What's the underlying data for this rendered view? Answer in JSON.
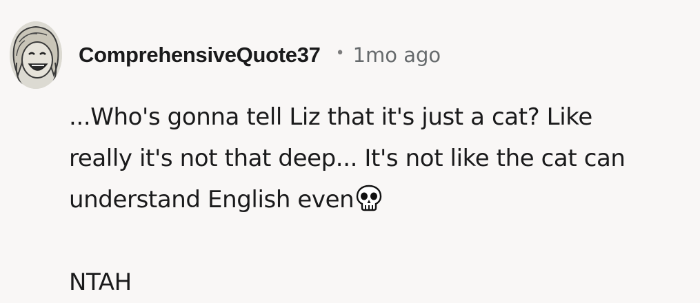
{
  "comment": {
    "username": "ComprehensiveQuote37",
    "separator": "•",
    "timestamp": "1mo ago",
    "body_lines": [
      "...Who's gonna tell Liz that it's just a cat? Like",
      "really it's not that deep... It's not like the cat can",
      "understand English even"
    ],
    "emoji": "skull-emoji",
    "verdict": "NTAH"
  },
  "colors": {
    "background": "#f9f7f6",
    "text": "#1a1a1b",
    "meta": "#666a6c"
  }
}
